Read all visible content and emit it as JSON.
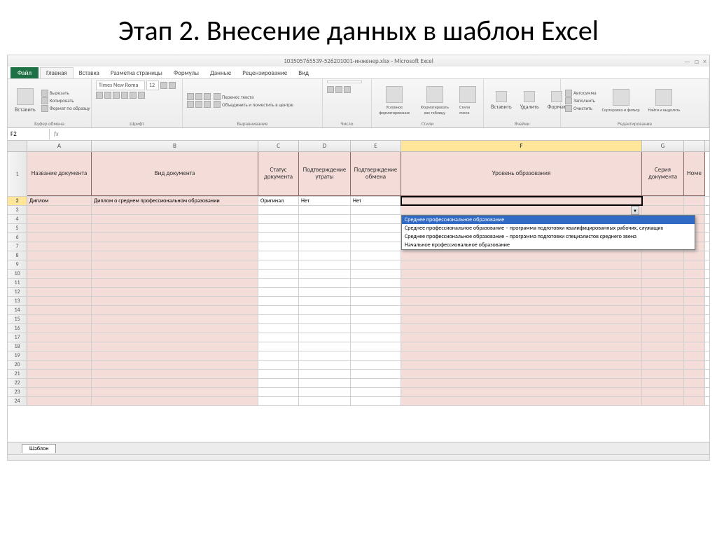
{
  "slide": {
    "title": "Этап 2. Внесение данных в шаблон Excel"
  },
  "window": {
    "title": "103505765539-526201001-инженер.xlsx - Microsoft Excel",
    "min": "—",
    "max": "□",
    "close": "×"
  },
  "menu": {
    "file": "Файл",
    "tabs": [
      "Главная",
      "Вставка",
      "Разметка страницы",
      "Формулы",
      "Данные",
      "Рецензирование",
      "Вид"
    ]
  },
  "ribbon": {
    "clipboard": {
      "title": "Буфер обмена",
      "paste": "Вставить",
      "cut": "Вырезать",
      "copy": "Копировать",
      "format": "Формат по образцу"
    },
    "font": {
      "title": "Шрифт",
      "name": "Times New Roma",
      "size": "12"
    },
    "align": {
      "title": "Выравнивание",
      "wrap": "Перенос текста",
      "merge": "Объединить и поместить в центре"
    },
    "number": {
      "title": "Число"
    },
    "styles": {
      "title": "Стили",
      "cond": "Условное форматирование",
      "table": "Форматировать как таблицу",
      "cell": "Стили ячеек"
    },
    "cells": {
      "title": "Ячейки",
      "insert": "Вставить",
      "delete": "Удалить",
      "format": "Формат"
    },
    "editing": {
      "title": "Редактирование",
      "sum": "Автосумма",
      "fill": "Заполнить",
      "clear": "Очистить",
      "sort": "Сортировка и фильтр",
      "find": "Найти и выделить"
    }
  },
  "formula": {
    "cell_ref": "F2",
    "fx": "fx",
    "value": ""
  },
  "columns": [
    "A",
    "B",
    "C",
    "D",
    "E",
    "F",
    "G"
  ],
  "headers": {
    "A": "Название документа",
    "B": "Вид документа",
    "C": "Статус документа",
    "D": "Подтверждение утраты",
    "E": "Подтверждение обмена",
    "F": "Уровень образования",
    "G": "Серия документа",
    "H": "Номе"
  },
  "data_row": {
    "A": "Диплом",
    "B": "Диплом о среднем профессиональном образовании",
    "C": "Оригинал",
    "D": "Нет",
    "E": "Нет",
    "F": ""
  },
  "dropdown": {
    "items": [
      "Среднее профессиональное образование",
      "Среднее профессиональное образование – программа подготовки квалифицированных рабочих, служащих",
      "Среднее профессиональное образование – программа подготовки специалистов среднего звена",
      "Начальное профессиональное образование"
    ]
  },
  "sheet": {
    "name": "Шаблон"
  },
  "row_count": 24
}
